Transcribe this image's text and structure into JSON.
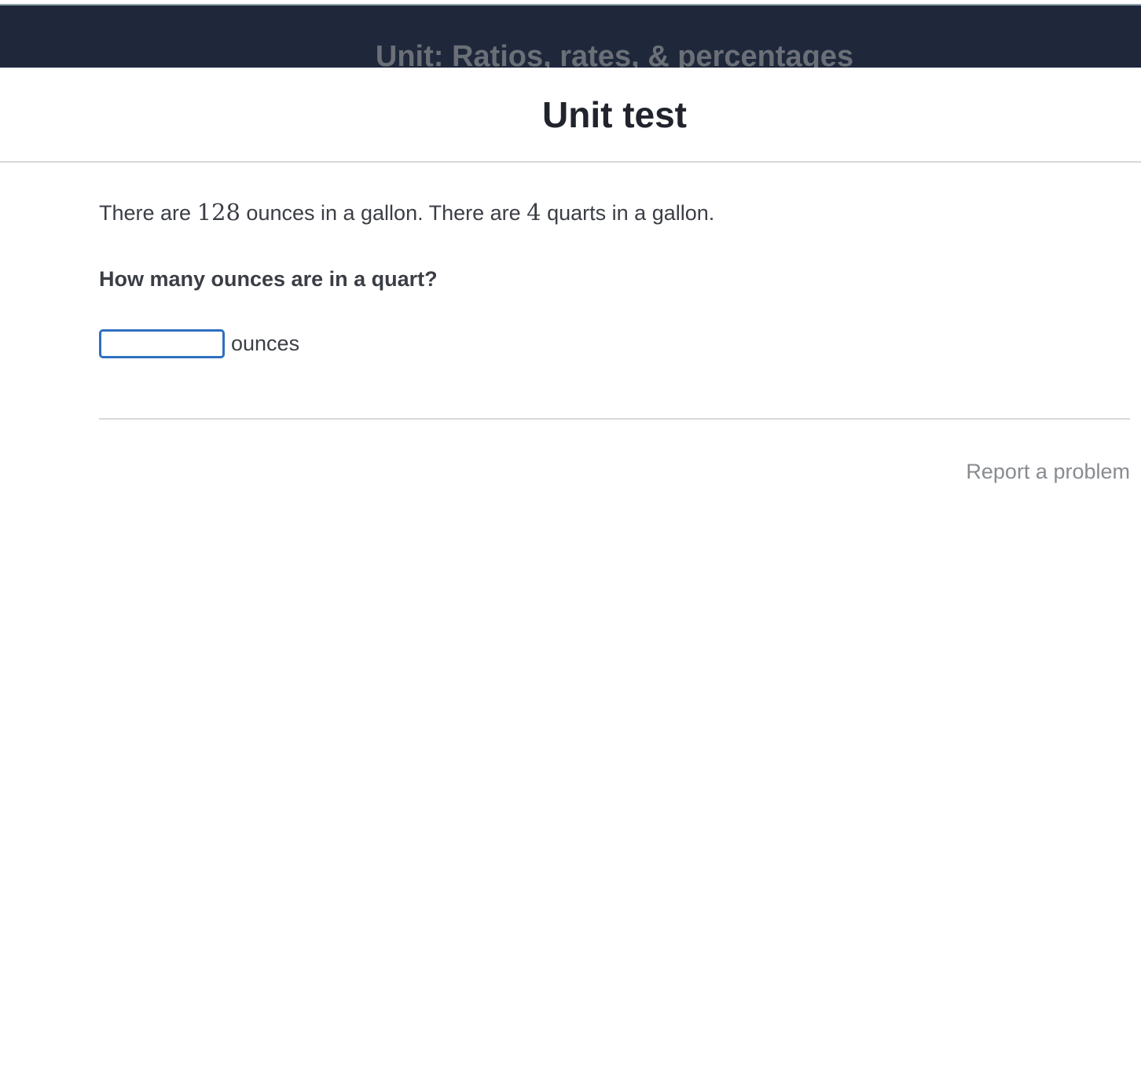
{
  "banner": {
    "unit_title": "Unit: Ratios, rates, & percentages"
  },
  "header": {
    "title": "Unit test"
  },
  "question": {
    "stem_part1": "There are ",
    "value_ounces_per_gallon": "128",
    "stem_part2": " ounces in a gallon. There are ",
    "value_quarts_per_gallon": "4",
    "stem_part3": " quarts in a gallon.",
    "prompt": "How many ounces are in a quart?",
    "answer_value": "",
    "answer_unit": "ounces"
  },
  "footer": {
    "report_link": "Report a problem"
  },
  "colors": {
    "banner_bg": "#1f283b",
    "input_focus_border": "#2f6fc0",
    "link_gray": "#888b90"
  }
}
